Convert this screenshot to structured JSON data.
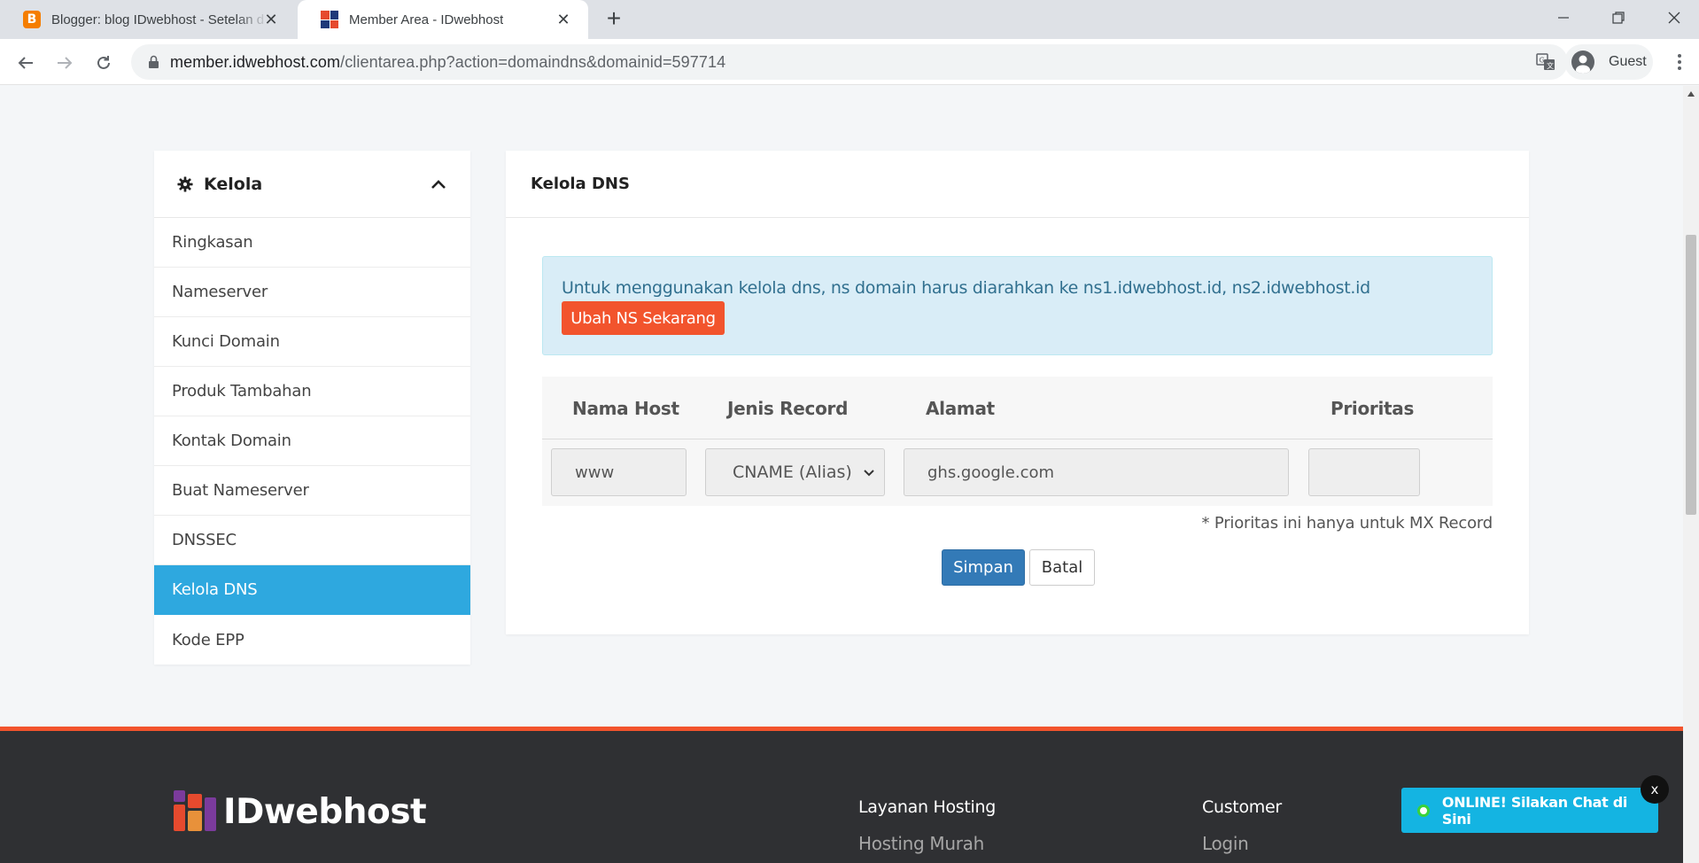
{
  "browser": {
    "tabs": [
      {
        "title": "Blogger: blog IDwebhost - Setelan d",
        "active": false
      },
      {
        "title": "Member Area - IDwebhost",
        "active": true
      }
    ],
    "url_host": "member.idwebhost.com",
    "url_path": "/clientarea.php?action=domaindns&domainid=597714",
    "profile_label": "Guest"
  },
  "sidebar": {
    "title": "Kelola",
    "items": [
      {
        "label": "Ringkasan"
      },
      {
        "label": "Nameserver"
      },
      {
        "label": "Kunci Domain"
      },
      {
        "label": "Produk Tambahan"
      },
      {
        "label": "Kontak Domain"
      },
      {
        "label": "Buat Nameserver"
      },
      {
        "label": "DNSSEC"
      },
      {
        "label": "Kelola DNS",
        "active": true
      },
      {
        "label": "Kode EPP"
      }
    ]
  },
  "panel": {
    "title": "Kelola DNS",
    "alert_text": "Untuk menggunakan kelola dns, ns domain harus diarahkan ke ns1.idwebhost.id, ns2.idwebhost.id",
    "alert_button": "Ubah NS Sekarang",
    "table": {
      "headers": [
        "Nama Host",
        "Jenis Record",
        "Alamat",
        "Prioritas"
      ],
      "row": {
        "host": "www",
        "record_type": "CNAME (Alias)",
        "address": "ghs.google.com",
        "priority": ""
      }
    },
    "note": "* Prioritas ini hanya untuk MX Record",
    "save_label": "Simpan",
    "cancel_label": "Batal"
  },
  "footer": {
    "logo_text": "IDwebhost",
    "col1_title": "Layanan Hosting",
    "col1_link": "Hosting Murah",
    "col2_title": "Customer",
    "col2_link": "Login"
  },
  "chat": {
    "text": "ONLINE! Silakan Chat di Sini",
    "close_label": "x"
  },
  "colors": {
    "accent_orange": "#f2542d",
    "active_blue": "#2ea8df",
    "save_blue": "#337ab7",
    "alert_bg": "#d9edf7",
    "footer_bg": "#2f3033",
    "chat_bg": "#14b4e2"
  }
}
